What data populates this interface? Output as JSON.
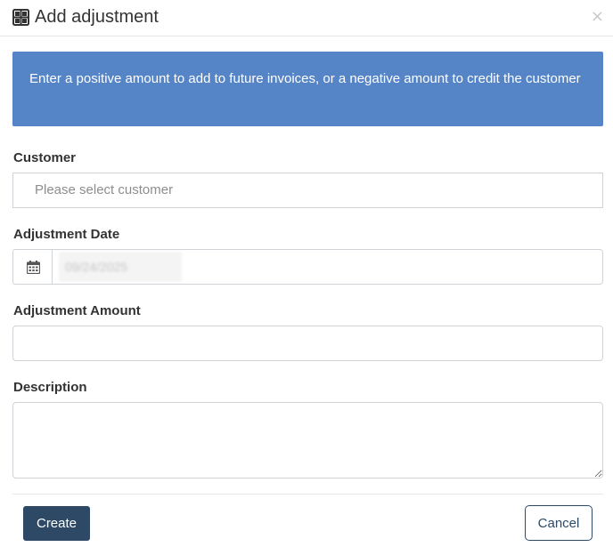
{
  "modal": {
    "title": "Add adjustment",
    "title_icon": "grid-squares-icon",
    "close_label": "×",
    "close_icon": "close-icon"
  },
  "banner": {
    "text": "Enter a positive amount to add to future invoices, or a negative amount to credit the customer",
    "background": "#5584c7"
  },
  "form": {
    "customer": {
      "label": "Customer",
      "placeholder": "Please select customer"
    },
    "adjustment_date": {
      "label": "Adjustment Date",
      "icon": "calendar-icon",
      "value": "09/24/2025"
    },
    "adjustment_amount": {
      "label": "Adjustment Amount",
      "value": ""
    },
    "description": {
      "label": "Description",
      "value": ""
    }
  },
  "footer": {
    "create_label": "Create",
    "cancel_label": "Cancel",
    "primary_color": "#2d4966"
  }
}
